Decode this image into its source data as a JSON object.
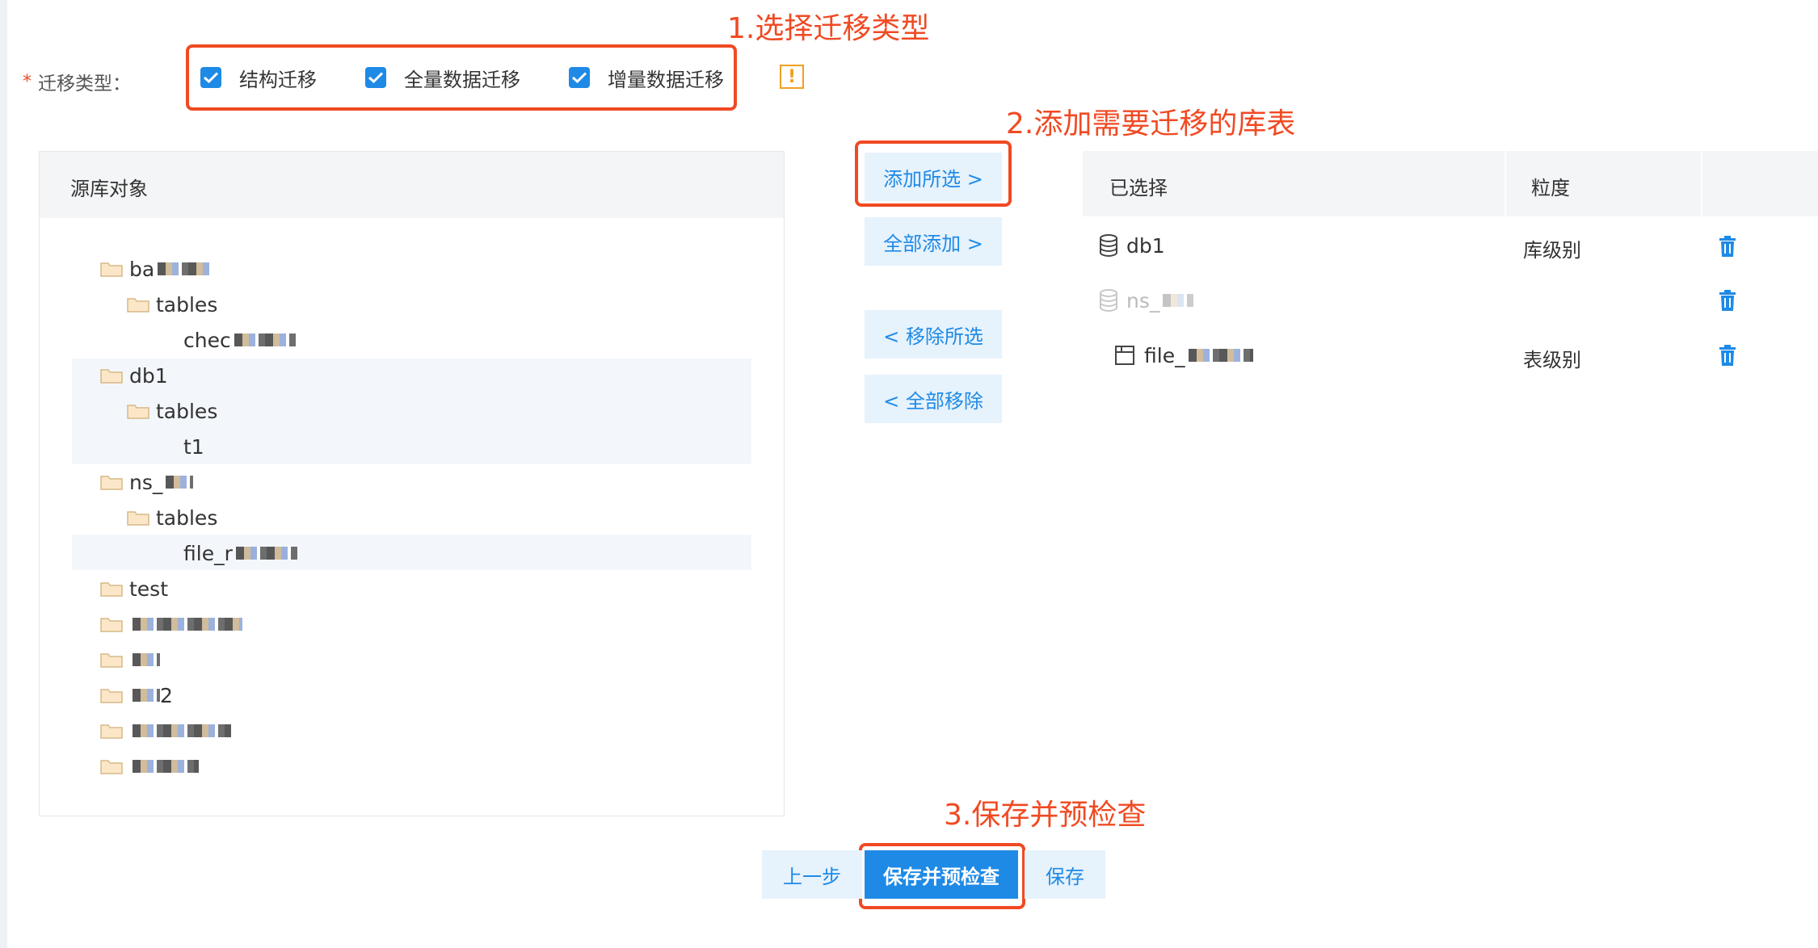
{
  "annotations": {
    "step1": "1.选择迁移类型",
    "step2": "2.添加需要迁移的库表",
    "step3": "3.保存并预检查"
  },
  "colors": {
    "accent": "#1e8ae6",
    "annotation": "#f04a23",
    "warning": "#f0a020",
    "header_bg": "#f4f5f7",
    "button_bg": "#e6f2fc"
  },
  "migration_type": {
    "required_mark": "*",
    "label": "迁移类型：",
    "options": [
      {
        "label": "结构迁移",
        "checked": true
      },
      {
        "label": "全量数据迁移",
        "checked": true
      },
      {
        "label": "增量数据迁移",
        "checked": true
      }
    ],
    "warning_icon": "!"
  },
  "source_panel": {
    "header": "源库对象",
    "tree": [
      {
        "label": "ba",
        "icon": "folder-icon",
        "level": 0,
        "redacted": true
      },
      {
        "label": "tables",
        "icon": "folder-icon",
        "level": 1
      },
      {
        "label": "chec",
        "icon": "none",
        "level": 2,
        "redacted": true
      },
      {
        "label": "db1",
        "icon": "folder-icon",
        "level": 0,
        "highlighted": true
      },
      {
        "label": "tables",
        "icon": "folder-icon",
        "level": 1,
        "highlighted": true
      },
      {
        "label": "t1",
        "icon": "none",
        "level": 2,
        "highlighted": true
      },
      {
        "label": "ns_",
        "icon": "folder-icon",
        "level": 0,
        "redacted": true
      },
      {
        "label": "tables",
        "icon": "folder-icon",
        "level": 1
      },
      {
        "label": "file_r",
        "icon": "none",
        "level": 2,
        "highlighted": true,
        "redacted": true
      },
      {
        "label": "test",
        "icon": "folder-icon",
        "level": 0
      },
      {
        "label": "",
        "icon": "folder-icon",
        "level": 0,
        "redacted": true
      },
      {
        "label": "",
        "icon": "folder-icon",
        "level": 0,
        "redacted": true
      },
      {
        "label": "2",
        "icon": "folder-icon",
        "level": 0,
        "redacted": true
      },
      {
        "label": "",
        "icon": "folder-icon",
        "level": 0,
        "redacted": true
      },
      {
        "label": "",
        "icon": "folder-icon",
        "level": 0,
        "redacted": true
      }
    ]
  },
  "actions": {
    "add_selected": "添加所选 >",
    "add_all": "全部添加 >",
    "remove_selected": "< 移除所选",
    "remove_all": "< 全部移除"
  },
  "selected_panel": {
    "col_selected": "已选择",
    "col_granularity": "粒度",
    "rows": [
      {
        "name": "db1",
        "icon": "database-icon",
        "granularity": "库级别",
        "disabled": false
      },
      {
        "name": "ns_",
        "icon": "database-icon",
        "granularity": "",
        "disabled": true
      },
      {
        "name": "file_",
        "icon": "table-icon",
        "granularity": "表级别",
        "disabled": false
      }
    ]
  },
  "footer": {
    "prev": "上一步",
    "save_precheck": "保存并预检查",
    "save": "保存"
  }
}
